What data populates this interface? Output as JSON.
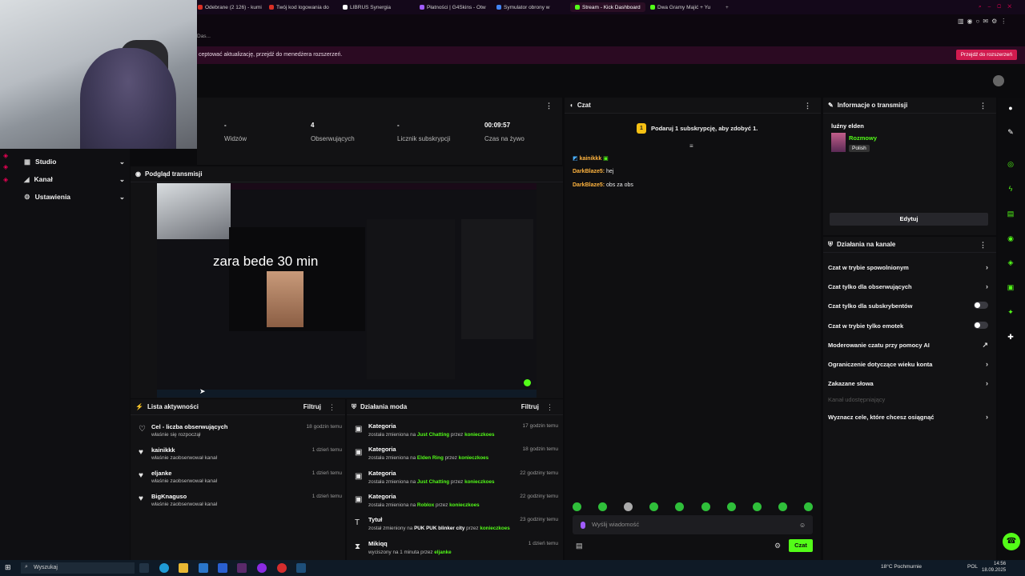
{
  "browser": {
    "tabs": [
      {
        "label": "Odebrane (2 126) - kumi",
        "color": "#d93025"
      },
      {
        "label": "Twój kod logowania do",
        "color": "#d93025"
      },
      {
        "label": "LIBRUS Synergia",
        "color": "#ffffff"
      },
      {
        "label": "Płatności | G4Skins - Otw",
        "color": "#a05cff"
      },
      {
        "label": "Symulator obrony w",
        "color": "#4285f4"
      },
      {
        "label": "Stream - Kick Dashboard",
        "color": "#53fc18"
      },
      {
        "label": "Dwa Gramy Majić + Yu",
        "color": "#53fc18"
      }
    ],
    "window_hint": "Das...",
    "extension_notice": "zaktualizowane rozszerzenie — zaakceptować aktualizację, przejdź do menedżera rozszerzeń.",
    "extension_notice_visible": "ceptować aktualizację, przejdź do menedżera rozszerzeń.",
    "extension_button": "Przejdź do rozszerzeń"
  },
  "sidebar": {
    "items": [
      {
        "label": "Studio",
        "icon": "grid-icon"
      },
      {
        "label": "Kanał",
        "icon": "megaphone-icon"
      },
      {
        "label": "Ustawienia",
        "icon": "gear-icon"
      }
    ]
  },
  "stats": [
    {
      "value": "-",
      "label": "Widzów"
    },
    {
      "value": "4",
      "label": "Obserwujących"
    },
    {
      "value": "-",
      "label": "Licznik subskrypcji"
    },
    {
      "value": "00:09:57",
      "label": "Czas na żywo"
    }
  ],
  "preview": {
    "title": "Podgląd transmisji",
    "overlay_text": "zara bede 30 min"
  },
  "activity": {
    "title": "Lista aktywności",
    "filter": "Filtruj",
    "rows": [
      {
        "name": "Cel - liczba obserwujących",
        "sub": "właśnie się rozpoczął",
        "time": "18 godzin temu",
        "icon": "target-icon"
      },
      {
        "name": "kainikkk",
        "sub": "właśnie zaobserwował kanał",
        "time": "1 dzień temu",
        "icon": "heart-icon"
      },
      {
        "name": "eljanke",
        "sub": "właśnie zaobserwował kanał",
        "time": "1 dzień temu",
        "icon": "heart-icon"
      },
      {
        "name": "BigKnaguso",
        "sub": "właśnie zaobserwował kanał",
        "time": "1 dzień temu",
        "icon": "heart-icon"
      }
    ]
  },
  "mod": {
    "title": "Działania moda",
    "filter": "Filtruj",
    "rows": [
      {
        "name": "Kategoria",
        "pre": "została zmieniona na",
        "value": "Just Chatting",
        "mid": "przez",
        "user": "konieczkoes",
        "time": "17 godzin temu"
      },
      {
        "name": "Kategoria",
        "pre": "została zmieniona na",
        "value": "Elden Ring",
        "mid": "przez",
        "user": "konieczkoes",
        "time": "18 godzin temu"
      },
      {
        "name": "Kategoria",
        "pre": "została zmieniona na",
        "value": "Just Chatting",
        "mid": "przez",
        "user": "konieczkoes",
        "time": "22 godziny temu"
      },
      {
        "name": "Kategoria",
        "pre": "została zmieniona na",
        "value": "Roblox",
        "mid": "przez",
        "user": "konieczkoes",
        "time": "22 godziny temu"
      },
      {
        "name": "Tytuł",
        "pre": "został zmieniony na",
        "value": "PUK PUK blinker city",
        "mid": "przez",
        "user": "konieczkoes",
        "time": "23 godziny temu"
      },
      {
        "name": "Mikiqq",
        "pre": "wyciszony na 1 minuta przez",
        "value": "",
        "mid": "",
        "user": "eljanke",
        "time": "1 dzień temu"
      }
    ]
  },
  "chat": {
    "title": "Czat",
    "gift_text": "Podaruj 1 subskrypcję, aby zdobyć 1.",
    "gift_coin": "1",
    "messages": [
      {
        "user": "kainikkk",
        "text": ""
      },
      {
        "user": "DarkBlaze5:",
        "text": "hej"
      },
      {
        "user": "DarkBlaze5:",
        "text": "obs za obs"
      }
    ],
    "input_placeholder": "Wyślij wiadomość",
    "send_label": "Czat"
  },
  "info": {
    "title": "Informacje o transmisji",
    "stream_title": "luźny elden",
    "category": "Rozmowy",
    "language": "Polish",
    "edit_label": "Edytuj"
  },
  "channel_actions": {
    "title": "Działania na kanale",
    "items": [
      {
        "label": "Czat w trybie spowolnionym",
        "control": "chevron"
      },
      {
        "label": "Czat tylko dla obserwujących",
        "control": "chevron"
      },
      {
        "label": "Czat tylko dla subskrybentów",
        "control": "toggle"
      },
      {
        "label": "Czat w trybie tylko emotek",
        "control": "toggle"
      },
      {
        "label": "Moderowanie czatu przy pomocy AI",
        "control": "external"
      },
      {
        "label": "Ograniczenie dotyczące wieku konta",
        "control": "chevron"
      },
      {
        "label": "Zakazane słowa",
        "control": "chevron"
      },
      {
        "label": "Kanał udostępniający",
        "control": "none"
      },
      {
        "label": "Wyznacz cele, które chcesz osiągnąć",
        "control": "chevron"
      }
    ]
  },
  "taskbar": {
    "search_placeholder": "Wyszukaj",
    "weather": "18°C Pochmurnie",
    "lang": "POL",
    "time": "14:56",
    "date": "18.09.2025"
  },
  "colors": {
    "accent": "#53fc18",
    "brand": "#d11b4f"
  }
}
